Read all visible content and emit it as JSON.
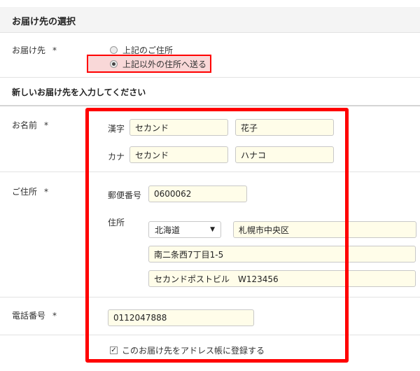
{
  "header": {
    "title": "お届け先の選択"
  },
  "destination": {
    "label": "お届け先",
    "required": "*",
    "options": [
      {
        "label": "上記のご住所",
        "selected": false
      },
      {
        "label": "上記以外の住所へ送る",
        "selected": true
      }
    ]
  },
  "new_address": {
    "title": "新しいお届け先を入力してください"
  },
  "name": {
    "label": "お名前",
    "required": "*",
    "kanji_label": "漢字",
    "kanji_last": "セカンド",
    "kanji_first": "花子",
    "kana_label": "カナ",
    "kana_last": "セカンド",
    "kana_first": "ハナコ"
  },
  "address": {
    "label": "ご住所",
    "required": "*",
    "postal_label": "郵便番号",
    "postal_value": "0600062",
    "addr_label": "住所",
    "prefecture": "北海道",
    "city": "札幌市中央区",
    "street": "南二条西7丁目1-5",
    "building": "セカンドポストビル　W123456"
  },
  "phone": {
    "label": "電話番号",
    "required": "*",
    "value": "0112047888"
  },
  "register": {
    "label": "このお届け先をアドレス帳に登録する",
    "checked": true
  },
  "icons": {
    "dropdown": "▼",
    "check": "✓"
  },
  "colors": {
    "highlight": "#ff0000",
    "highlight_fill": "#f9d8d8",
    "field_bg": "#fffde9"
  }
}
